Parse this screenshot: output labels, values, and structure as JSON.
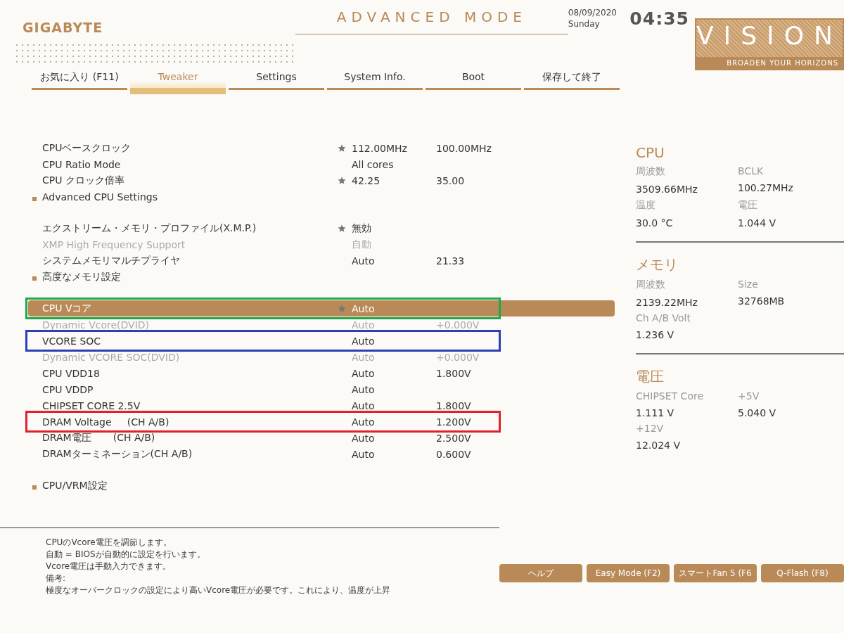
{
  "header": {
    "brand": "GIGABYTE",
    "mode": "ADVANCED MODE",
    "date": "08/09/2020",
    "weekday": "Sunday",
    "time": "04:35",
    "badge": {
      "title": "VISION",
      "tagline": "BROADEN YOUR HORIZONS"
    }
  },
  "tabs": [
    {
      "label": "お気に入り (F11)",
      "selected": false
    },
    {
      "label": "Tweaker",
      "selected": true
    },
    {
      "label": "Settings",
      "selected": false
    },
    {
      "label": "System Info.",
      "selected": false
    },
    {
      "label": "Boot",
      "selected": false
    },
    {
      "label": "保存して終了",
      "selected": false
    }
  ],
  "groups": [
    {
      "items": [
        {
          "kind": "setting",
          "name": "CPUベースクロック",
          "value": "112.00MHz",
          "default": "100.00MHz",
          "starred": true,
          "disabled": false,
          "selected": false
        },
        {
          "kind": "setting",
          "name": "CPU Ratio Mode",
          "value": "All cores",
          "starred": false,
          "disabled": false,
          "selected": false
        },
        {
          "kind": "setting",
          "name": "CPU クロック倍率",
          "value": "42.25",
          "default": "35.00",
          "starred": true,
          "disabled": false,
          "selected": false
        },
        {
          "kind": "submenu",
          "name": "Advanced CPU Settings",
          "selected": false
        }
      ]
    },
    {
      "items": [
        {
          "kind": "setting",
          "name": "エクストリーム・メモリ・プロファイル(X.M.P.)",
          "value": "無効",
          "starred": true,
          "disabled": false,
          "selected": false
        },
        {
          "kind": "setting",
          "name": "XMP High Frequency Support",
          "value": "自動",
          "starred": false,
          "disabled": true,
          "selected": false
        },
        {
          "kind": "setting",
          "name": "システムメモリマルチプライヤ",
          "value": "Auto",
          "default": "21.33",
          "starred": false,
          "disabled": false,
          "selected": false
        },
        {
          "kind": "submenu",
          "name": "高度なメモリ設定",
          "selected": false
        }
      ]
    },
    {
      "items": [
        {
          "kind": "setting",
          "name": "CPU Vコア",
          "value": "Auto",
          "starred": true,
          "disabled": false,
          "selected": true,
          "color": "#1fa84a"
        },
        {
          "kind": "setting",
          "name": "Dynamic Vcore(DVID)",
          "value": "Auto",
          "default": "+0.000V",
          "starred": false,
          "disabled": true,
          "selected": false
        },
        {
          "kind": "setting",
          "name": "VCORE SOC",
          "value": "Auto",
          "starred": false,
          "disabled": false,
          "selected": false,
          "color": "#2b3fb8"
        },
        {
          "kind": "setting",
          "name": "Dynamic VCORE SOC(DVID)",
          "value": "Auto",
          "default": "+0.000V",
          "starred": false,
          "disabled": true,
          "selected": false
        },
        {
          "kind": "setting",
          "name": "CPU VDD18",
          "value": "Auto",
          "default": "1.800V",
          "starred": false,
          "disabled": false,
          "selected": false
        },
        {
          "kind": "setting",
          "name": "CPU VDDP",
          "value": "Auto",
          "starred": false,
          "disabled": false,
          "selected": false
        },
        {
          "kind": "setting",
          "name": "CHIPSET CORE 2.5V",
          "value": "Auto",
          "default": "1.800V",
          "starred": false,
          "disabled": false,
          "selected": false
        },
        {
          "kind": "setting",
          "name": "DRAM Voltage     (CH A/B)",
          "value": "Auto",
          "default": "1.200V",
          "starred": false,
          "disabled": false,
          "selected": false,
          "color": "#e0202a"
        },
        {
          "kind": "setting",
          "name": "DRAM電圧       (CH A/B)",
          "value": "Auto",
          "default": "2.500V",
          "starred": false,
          "disabled": false,
          "selected": false
        },
        {
          "kind": "setting",
          "name": "DRAMターミネーション(CH A/B)",
          "value": "Auto",
          "default": "0.600V",
          "starred": false,
          "disabled": false,
          "selected": false
        }
      ]
    },
    {
      "items": [
        {
          "kind": "submenu",
          "name": "CPU/VRM設定",
          "selected": false
        }
      ]
    }
  ],
  "monitor": [
    {
      "title": "CPU",
      "fields": [
        {
          "label": "周波数",
          "value": "3509.66MHz"
        },
        {
          "label": "BCLK",
          "value": "100.27MHz"
        },
        {
          "label": "温度",
          "value": "30.0 °C"
        },
        {
          "label": "電圧",
          "value": "1.044 V"
        }
      ]
    },
    {
      "title": "メモリ",
      "fields": [
        {
          "label": "周波数",
          "value": "2139.22MHz"
        },
        {
          "label": "Size",
          "value": "32768MB"
        },
        {
          "label": "Ch A/B Volt",
          "value": "1.236 V"
        }
      ]
    },
    {
      "title": "電圧",
      "fields": [
        {
          "label": "CHIPSET Core",
          "value": "1.111 V"
        },
        {
          "label": "+5V",
          "value": "5.040 V"
        },
        {
          "label": "+12V",
          "value": "12.024 V"
        }
      ]
    }
  ],
  "help": [
    "CPUのVcore電圧を調節します。",
    "自動 = BIOSが自動的に設定を行います。",
    "Vcore電圧は手動入力できます。",
    "備考:",
    "極度なオーバークロックの設定により高いVcore電圧が必要です。これにより、温度が上昇"
  ],
  "buttons": [
    "ヘルプ",
    "Easy Mode (F2)",
    "スマートFan 5 (F6",
    "Q-Flash (F8)"
  ]
}
